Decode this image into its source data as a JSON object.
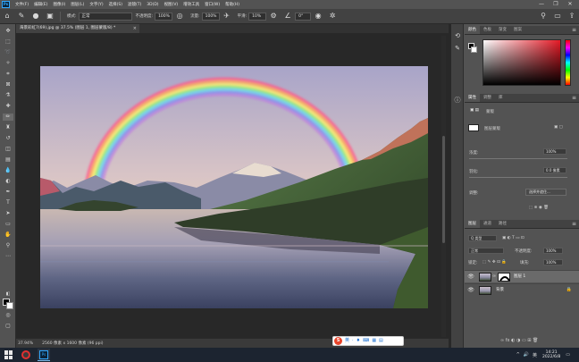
{
  "app": {
    "logo": "Ps"
  },
  "menubar": {
    "items": [
      "文件(F)",
      "编辑(E)",
      "图像(I)",
      "图层(L)",
      "文字(Y)",
      "选择(S)",
      "滤镜(T)",
      "3D(D)",
      "视图(V)",
      "增效工具",
      "窗口(W)",
      "帮助(H)"
    ],
    "window_buttons": [
      "—",
      "❐",
      "✕"
    ]
  },
  "options": {
    "mode_label": "模式:",
    "mode_value": "正常",
    "opacity_label": "不透明度:",
    "opacity_value": "100%",
    "flow_label": "流量:",
    "flow_value": "100%",
    "smooth_label": "平滑:",
    "smooth_value": "10%",
    "angle_value": "0°"
  },
  "document": {
    "tab_title": "海景彩虹7(69).jpg @ 37.5% (图层 1, 图层蒙版/8) *",
    "tab_close": "×",
    "zoom": "37.94%",
    "doc_info": "2560 像素 x 1600 像素 (96 ppi)"
  },
  "ime": {
    "logo": "S",
    "items": [
      "英",
      "·",
      "♦",
      "⌨",
      "▦",
      "▤"
    ]
  },
  "color_panel": {
    "tabs": [
      "颜色",
      "色板",
      "渐变",
      "图案"
    ],
    "active": 0
  },
  "properties_panel": {
    "tabs": [
      "属性",
      "调整",
      "库"
    ],
    "section_label": "蒙版",
    "layer_mask_label": "图层蒙版",
    "density_label": "浓度:",
    "density_value": "100%",
    "feather_label": "羽化:",
    "feather_value": "0.0 像素",
    "refine_label": "调整:",
    "refine_button": "选择并遮住..."
  },
  "layers_panel": {
    "tabs": [
      "图层",
      "通道",
      "路径"
    ],
    "kind_label": "Q 类型",
    "blend_mode": "正常",
    "opacity_label": "不透明度:",
    "opacity_value": "100%",
    "lock_label": "锁定:",
    "fill_label": "填充:",
    "fill_value": "100%",
    "layers": [
      {
        "name": "图层 1",
        "selected": true,
        "locked": false
      },
      {
        "name": "背景",
        "selected": false,
        "locked": true
      }
    ]
  },
  "taskbar": {
    "time": "14:21",
    "date": "2022/6/8",
    "tray_icons": [
      "^",
      "🔊",
      "英"
    ]
  }
}
